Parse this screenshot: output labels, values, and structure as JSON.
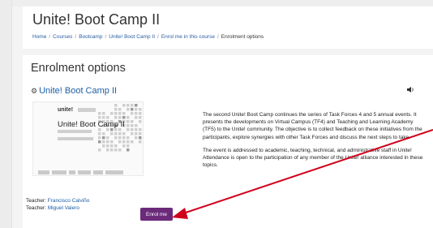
{
  "header": {
    "title": "Unite! Boot Camp II",
    "breadcrumb": [
      "Home",
      "Courses",
      "Bootcamp",
      "Unite! Boot Camp II",
      "Enrol me in this course"
    ],
    "breadcrumb_current": "Enrolment options"
  },
  "main": {
    "section_title": "Enrolment options",
    "course": {
      "name": "Unite! Boot Camp II",
      "image": {
        "logo_text": "unite!",
        "title": "Unite! Boot Camp II"
      },
      "summary_p1": "The second Unite! Boot Camp continues the series of Task Forces 4 and 5 annual events. It presents the developments on Virtual Campus (TF4) and Teaching and Learning Academy (TF5) to the Unite! community. The objective is to collect feedback on these initiatives from the participants, explore synergies with other Task Forces and discuss the next steps to take.",
      "summary_p2": "The event is addressed to academic, teaching, technical, and administrative staff in Unite! Attendance is open to the participation of any member of the Unite! alliance interested in these topics.",
      "teachers": [
        {
          "label": "Teacher:",
          "name": "Francisco Calviño"
        },
        {
          "label": "Teacher:",
          "name": "Miguel Valero"
        }
      ]
    },
    "enrol_button": "Enrol me"
  },
  "colors": {
    "accent": "#6b2a7a",
    "link": "#1b5ea6",
    "annotation_arrow": "#d0021b"
  },
  "icons": [
    "course-icon",
    "speaker-icon"
  ]
}
